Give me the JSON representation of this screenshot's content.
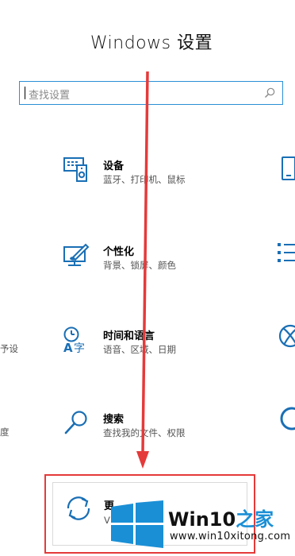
{
  "window": {
    "title": "Windows 设置"
  },
  "search": {
    "placeholder": "查找设置"
  },
  "items": [
    {
      "name": "设备",
      "desc": "蓝牙、打印机、鼠标",
      "icon": "devices-icon"
    },
    {
      "name": "个性化",
      "desc": "背景、锁屏、颜色",
      "icon": "personalization-icon"
    },
    {
      "name": "时间和语言",
      "desc": "语音、区域、日期",
      "icon": "time-language-icon"
    },
    {
      "name": "搜索",
      "desc": "查找我的文件、权限",
      "icon": "search-category-icon"
    }
  ],
  "left_partial": {
    "row3": "予设",
    "row4": "度"
  },
  "update": {
    "name": "更",
    "desc": "V",
    "icon": "update-sync-icon"
  },
  "watermark": {
    "brand_prefix": "Win10",
    "brand_suffix": "之家",
    "url": "www.win10xitong.com"
  },
  "colors": {
    "accent": "#1a6fb5",
    "highlight": "#e53a3a",
    "search_border": "#2b8fd6"
  }
}
